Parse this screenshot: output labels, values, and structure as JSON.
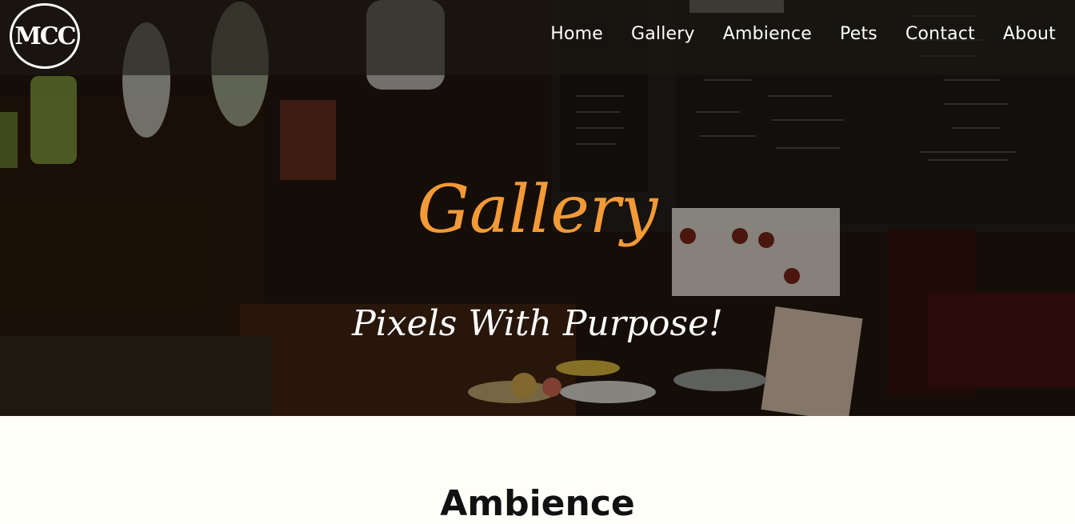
{
  "brand": {
    "logo_text": "MCC"
  },
  "nav": {
    "items": [
      {
        "label": "Home"
      },
      {
        "label": "Gallery"
      },
      {
        "label": "Ambience"
      },
      {
        "label": "Pets"
      },
      {
        "label": "Contact"
      },
      {
        "label": "About"
      }
    ]
  },
  "hero": {
    "title": "Gallery",
    "subtitle": "Pixels With Purpose!",
    "title_color": "#f39a37"
  },
  "section": {
    "title": "Ambience"
  }
}
